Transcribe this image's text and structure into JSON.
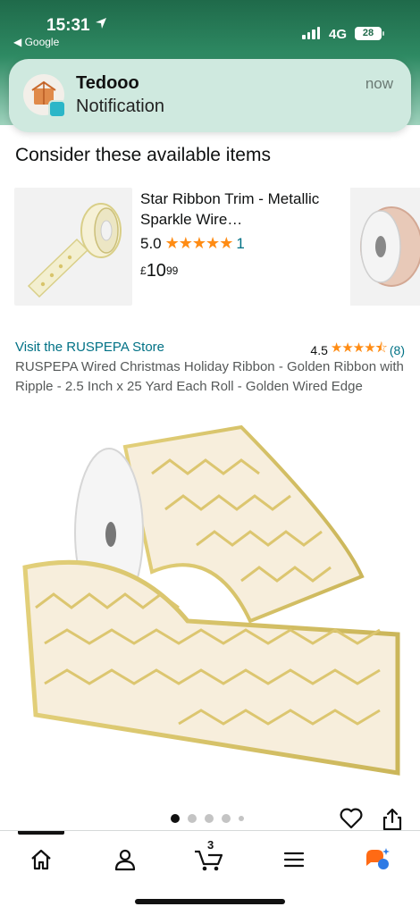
{
  "status_bar": {
    "time": "15:31",
    "back_app": "◀ Google",
    "network": "4G",
    "battery": "28"
  },
  "notification": {
    "app": "Tedooo",
    "body": "Notification",
    "time": "now"
  },
  "consider": {
    "title": "Consider these available items",
    "product": {
      "name": "Star Ribbon Trim - Metallic Sparkle Wire…",
      "rating": "5.0",
      "stars": "★★★★★",
      "review_count": "1",
      "currency": "£",
      "price_whole": "10",
      "price_fraction": "99"
    }
  },
  "main_product": {
    "store_link": "Visit the RUSPEPA Store",
    "rating": "4.5",
    "stars": "★★★★⯪",
    "review_count": "(8)",
    "title": "RUSPEPA Wired Christmas Holiday Ribbon - Golden Ribbon with Ripple - 2.5 Inch x 25 Yard Each Roll - Golden Wired Edge",
    "image_count": 5,
    "active_image_index": 0
  },
  "bottom_nav": {
    "items": [
      "home-icon",
      "account-icon",
      "cart-icon",
      "menu-icon",
      "rufus-icon"
    ],
    "cart_count": "3"
  },
  "colors": {
    "link": "#007185",
    "star": "#ff8c14",
    "status_bar": "#1f6a4a"
  }
}
